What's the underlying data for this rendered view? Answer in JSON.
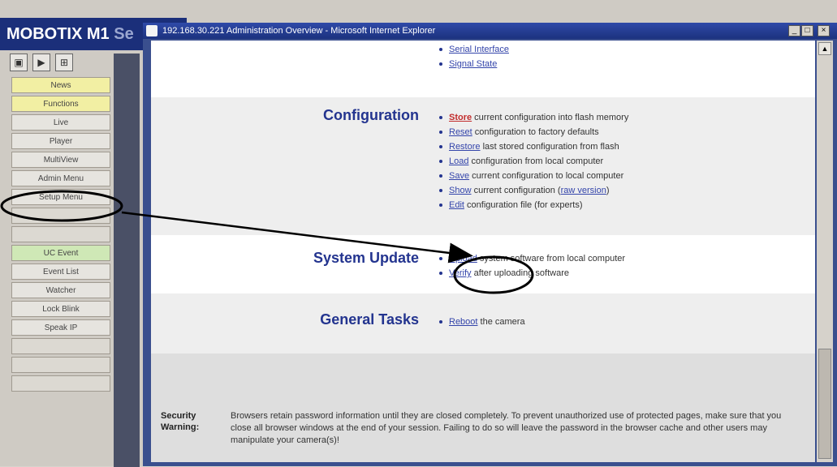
{
  "background_app": {
    "title": "MOBOTIX M1",
    "title_suffix": "Se",
    "toolbar": [
      "live-icon",
      "play-icon",
      "grid-icon"
    ],
    "sidebar": [
      {
        "label": "News",
        "style": "yellow"
      },
      {
        "label": "Functions",
        "style": "yellow"
      },
      {
        "label": "Live",
        "style": "normal"
      },
      {
        "label": "Player",
        "style": "normal"
      },
      {
        "label": "MultiView",
        "style": "normal"
      },
      {
        "label": "Admin Menu",
        "style": "normal"
      },
      {
        "label": "Setup Menu",
        "style": "normal"
      },
      {
        "label": "",
        "style": "blank"
      },
      {
        "label": "",
        "style": "blank"
      },
      {
        "label": "UC Event",
        "style": "green"
      },
      {
        "label": "Event List",
        "style": "normal"
      },
      {
        "label": "Watcher",
        "style": "normal"
      },
      {
        "label": "Lock Blink",
        "style": "normal"
      },
      {
        "label": "Speak IP",
        "style": "normal"
      },
      {
        "label": "",
        "style": "blank"
      },
      {
        "label": "",
        "style": "blank"
      },
      {
        "label": "",
        "style": "blank"
      }
    ]
  },
  "ie_window": {
    "title": "192.168.30.221 Administration Overview - Microsoft Internet Explorer",
    "controls": [
      "_",
      "□",
      "×"
    ]
  },
  "page": {
    "top_links": [
      {
        "link": "Serial Interface",
        "rest": ""
      },
      {
        "link": "Signal State",
        "rest": ""
      }
    ],
    "configuration": {
      "title": "Configuration",
      "items": [
        {
          "link": "Store",
          "rest": " current configuration into flash memory",
          "red": true
        },
        {
          "link": "Reset",
          "rest": " configuration to factory defaults",
          "red": false
        },
        {
          "link": "Restore",
          "rest": " last stored configuration from flash",
          "red": false
        },
        {
          "link": "Load",
          "rest": " configuration from local computer",
          "red": false
        },
        {
          "link": "Save",
          "rest": " current configuration to local computer",
          "red": false
        },
        {
          "link": "Show",
          "rest": " current configuration (",
          "link2": "raw version",
          "rest2": ")",
          "red": false
        },
        {
          "link": "Edit",
          "rest": " configuration file (for experts)",
          "red": false
        }
      ]
    },
    "system_update": {
      "title": "System Update",
      "items": [
        {
          "link": "Upload",
          "rest": " system software from local computer"
        },
        {
          "link": "Verify",
          "rest": " after uploading software"
        }
      ]
    },
    "general_tasks": {
      "title": "General Tasks",
      "items": [
        {
          "link": "Reboot",
          "rest": " the camera"
        }
      ]
    },
    "security_warning": {
      "label": "Security Warning:",
      "text": "Browsers retain password information until they are closed completely. To prevent unauthorized use of protected pages, make sure that you close all browser windows at the end of your session. Failing to do so will leave the password in the browser cache and other users may manipulate your camera(s)!"
    }
  },
  "colors": {
    "section_title": "#23348f",
    "link": "#3344aa",
    "link_highlight": "#c22c2c",
    "titlebar": "#1c327f"
  }
}
